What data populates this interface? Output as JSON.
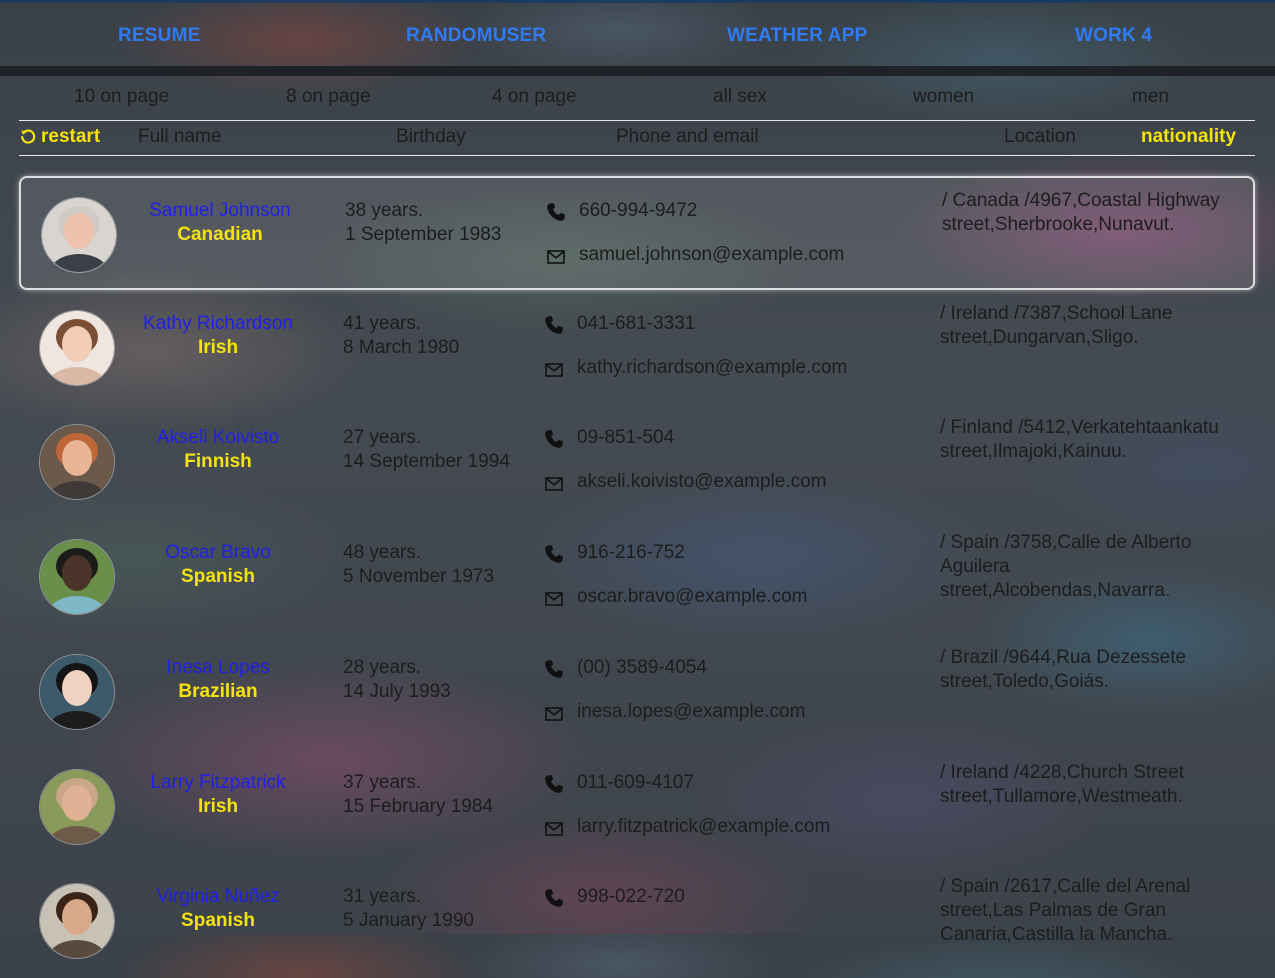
{
  "nav": {
    "resume": "RESUME",
    "randomuser": "RANDOMUSER",
    "weather": "WEATHER APP",
    "work4": "WORK 4"
  },
  "filters": {
    "ten": "10 on page",
    "eight": "8 on page",
    "four": "4 on page",
    "all_sex": "all sex",
    "women": "women",
    "men": "men"
  },
  "header": {
    "restart": "restart",
    "full_name": "Full name",
    "birthday": "Birthday",
    "phone_email": "Phone and email",
    "location": "Location",
    "nationality": "nationality"
  },
  "colors": {
    "link_blue": "#2f7bf5",
    "name_blue": "#2020e8",
    "accent_yellow": "#f4e30c"
  },
  "users": [
    {
      "name": "Samuel Johnson",
      "nationality": "Canadian",
      "age": "38 years.",
      "birth": "1 September 1983",
      "phone": "660-994-9472",
      "email": "samuel.johnson@example.com",
      "location": "/ Canada /4967,Coastal Highway street,Sherbrooke,Nunavut.",
      "selected": true
    },
    {
      "name": "Kathy Richardson",
      "nationality": "Irish",
      "age": "41 years.",
      "birth": "8 March 1980",
      "phone": "041-681-3331",
      "email": "kathy.richardson@example.com",
      "location": "/ Ireland /7387,School Lane street,Dungarvan,Sligo."
    },
    {
      "name": "Akseli Koivisto",
      "nationality": "Finnish",
      "age": "27 years.",
      "birth": "14 September 1994",
      "phone": "09-851-504",
      "email": "akseli.koivisto@example.com",
      "location": "/ Finland /5412,Verkatehtaankatu street,Ilmajoki,Kainuu."
    },
    {
      "name": "Oscar Bravo",
      "nationality": "Spanish",
      "age": "48 years.",
      "birth": "5 November 1973",
      "phone": "916-216-752",
      "email": "oscar.bravo@example.com",
      "location": "/ Spain /3758,Calle de Alberto Aguilera street,Alcobendas,Navarra."
    },
    {
      "name": "Inesa Lopes",
      "nationality": "Brazilian",
      "age": "28 years.",
      "birth": "14 July 1993",
      "phone": "(00) 3589-4054",
      "email": "inesa.lopes@example.com",
      "location": "/ Brazil /9644,Rua Dezessete street,Toledo,Goiás."
    },
    {
      "name": "Larry Fitzpatrick",
      "nationality": "Irish",
      "age": "37 years.",
      "birth": "15 February 1984",
      "phone": "011-609-4107",
      "email": "larry.fitzpatrick@example.com",
      "location": "/ Ireland /4228,Church Street street,Tullamore,Westmeath."
    },
    {
      "name": "Virginia Nuñez",
      "nationality": "Spanish",
      "age": "31 years.",
      "birth": "5 January 1990",
      "phone": "998-022-720",
      "email": "",
      "location": "/ Spain /2617,Calle del Arenal street,Las Palmas de Gran Canaria,Castilla la Mancha."
    }
  ]
}
